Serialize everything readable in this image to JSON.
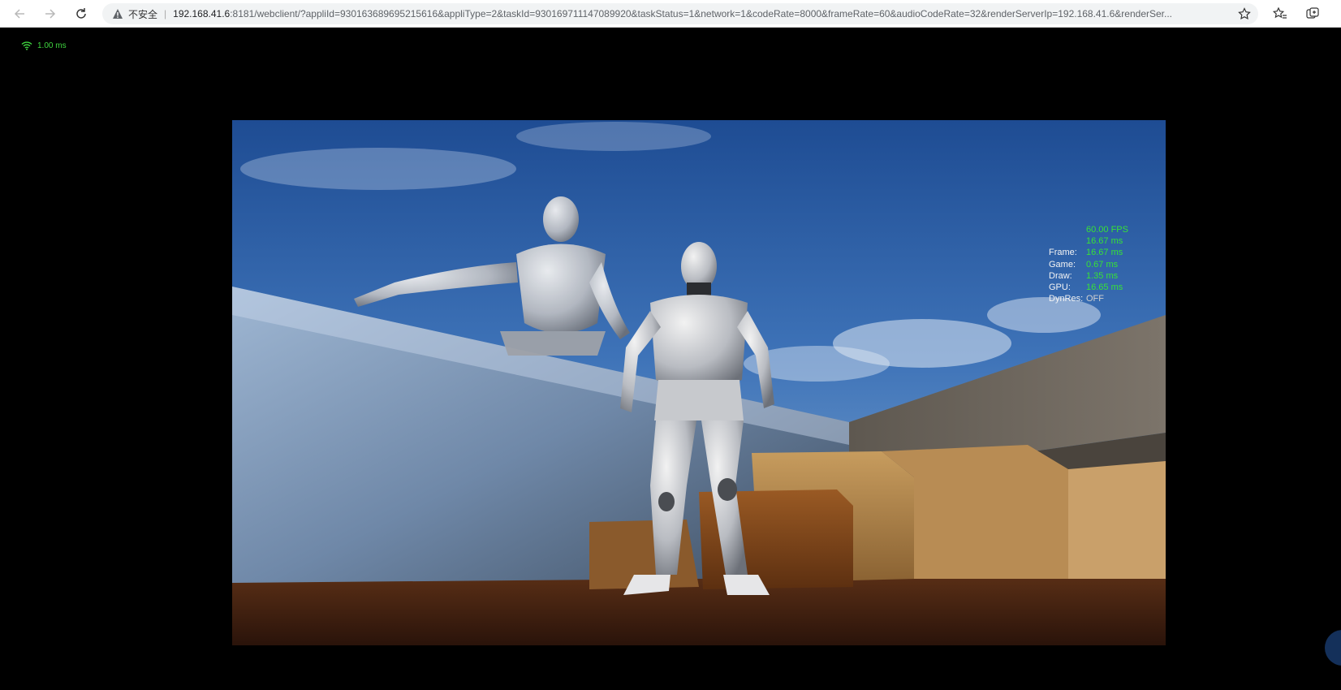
{
  "browser": {
    "security_label": "不安全",
    "separator": "|",
    "url_host": "192.168.41.6",
    "url_rest": ":8181/webclient/?appliId=930163689695215616&appliType=2&taskId=930169711147089920&taskStatus=1&network=1&codeRate=8000&frameRate=60&audioCodeRate=32&renderServerIp=192.168.41.6&renderSer..."
  },
  "network": {
    "latency": "1.00 ms",
    "accent": "#3fd43f"
  },
  "stats": {
    "fps": "60.00 FPS",
    "frame_ms": "16.67 ms",
    "rows": [
      {
        "label": "Frame:",
        "value": "16.67 ms"
      },
      {
        "label": "Game:",
        "value": "0.67 ms"
      },
      {
        "label": "Draw:",
        "value": "1.35 ms"
      },
      {
        "label": "GPU:",
        "value": "16.65 ms"
      },
      {
        "label": "DynRes:",
        "value": "OFF"
      }
    ],
    "value_color": "#37e137"
  }
}
